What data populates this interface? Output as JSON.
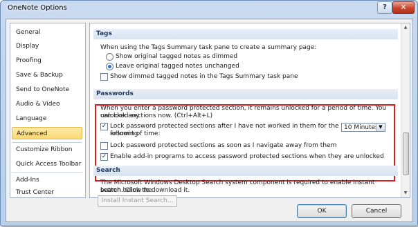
{
  "window": {
    "title": "OneNote Options",
    "help_label": "?",
    "close_label": "✕"
  },
  "sidebar": {
    "items": [
      {
        "label": "General"
      },
      {
        "label": "Display"
      },
      {
        "label": "Proofing"
      },
      {
        "label": "Save & Backup"
      },
      {
        "label": "Send to OneNote"
      },
      {
        "label": "Audio & Video"
      },
      {
        "label": "Language"
      },
      {
        "label": "Advanced",
        "selected": true
      },
      {
        "label": "Customize Ribbon"
      },
      {
        "label": "Quick Access Toolbar"
      },
      {
        "label": "Add-Ins"
      },
      {
        "label": "Trust Center"
      }
    ]
  },
  "tags": {
    "heading": "Tags",
    "intro": "When using the Tags Summary task pane to create a summary page:",
    "option_show": "Show original tagged notes as dimmed",
    "option_leave": "Leave original tagged notes unchanged",
    "show_dimmed": "Show dimmed tagged notes in the Tags Summary task pane"
  },
  "passwords": {
    "heading": "Passwords",
    "intro_line1": "When you enter a password protected section, it remains unlocked for a period of time. You can lock any",
    "intro_line2": "unlocked sections now. (Ctrl+Alt+L)",
    "lock_after_line1": "Lock password protected sections after I have not worked in them for the following",
    "lock_after_line2": "amount of time:",
    "lock_time_value": "10 Minutes",
    "lock_navigate": "Lock password protected sections as soon as I navigate away from them",
    "enable_addins": "Enable add-in programs to access password protected sections when they are unlocked"
  },
  "search": {
    "heading": "Search",
    "line1": "The Microsoft Windows Desktop Search system component is required to enable instant search. Click the",
    "line2": "button below to download it.",
    "install_label": "Install Instant Search..."
  },
  "buttons": {
    "ok": "OK",
    "cancel": "Cancel"
  },
  "colors": {
    "highlight_box": "#e01818",
    "selected_nav": "#fbd872"
  }
}
